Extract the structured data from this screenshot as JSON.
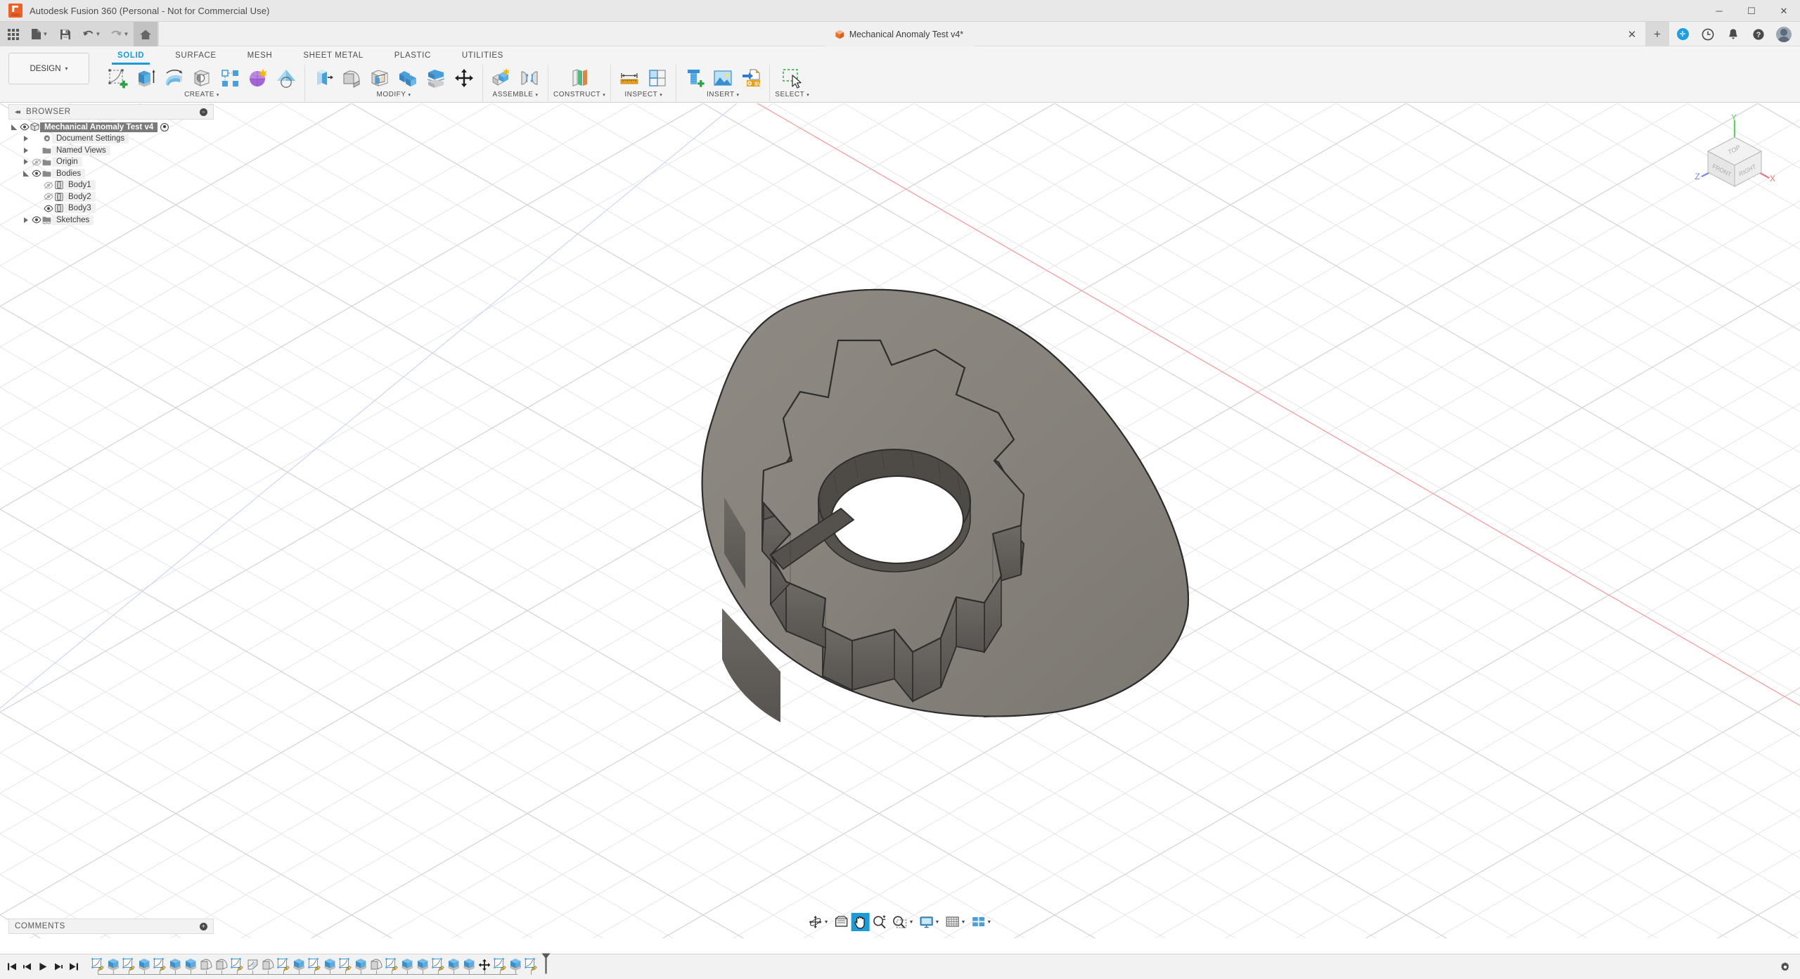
{
  "window": {
    "app_title": "Autodesk Fusion 360 (Personal - Not for Commercial Use)",
    "minimize": "─",
    "maximize": "☐",
    "close": "✕"
  },
  "quick_access": {
    "items": [
      {
        "name": "app-grid",
        "icon": "grid-icon",
        "label": "Apps"
      },
      {
        "name": "new-file",
        "icon": "file-icon",
        "label": "New",
        "has_carat": true
      },
      {
        "name": "save",
        "icon": "save-icon",
        "label": "Save"
      },
      {
        "name": "undo",
        "icon": "undo-icon",
        "label": "Undo",
        "has_carat": true
      },
      {
        "name": "redo",
        "icon": "redo-icon",
        "label": "Redo",
        "has_carat": true
      },
      {
        "name": "home",
        "icon": "home-icon",
        "label": "Home"
      }
    ]
  },
  "document_tab": {
    "title": "Mechanical Anomaly Test v4*",
    "icon": "cube-icon",
    "close_label": "✕",
    "new_tab_label": "+"
  },
  "account_bar": {
    "items": [
      {
        "name": "extension-badge",
        "icon": "plus-circle-icon"
      },
      {
        "name": "job-status",
        "icon": "clock-icon"
      },
      {
        "name": "notifications",
        "icon": "bell-icon"
      },
      {
        "name": "help",
        "icon": "question-icon"
      },
      {
        "name": "user-avatar",
        "icon": "avatar-icon"
      }
    ]
  },
  "workspace": {
    "label": "DESIGN",
    "carat": "▾"
  },
  "ribbon": {
    "tabs": [
      {
        "label": "SOLID",
        "active": true
      },
      {
        "label": "SURFACE",
        "active": false
      },
      {
        "label": "MESH",
        "active": false
      },
      {
        "label": "SHEET METAL",
        "active": false
      },
      {
        "label": "PLASTIC",
        "active": false
      },
      {
        "label": "UTILITIES",
        "active": false
      }
    ],
    "panels": [
      {
        "label": "CREATE",
        "carat": "▾",
        "tools": [
          {
            "name": "create-sketch-button",
            "icon": "sketch-plus-icon"
          },
          {
            "name": "extrude-button",
            "icon": "extrude-icon"
          },
          {
            "name": "revolve-button",
            "icon": "revolve-icon"
          },
          {
            "name": "hole-button",
            "icon": "hole-icon"
          },
          {
            "name": "rectangular-pattern-button",
            "icon": "pattern-icon"
          },
          {
            "name": "sphere-button",
            "icon": "sphere-icon"
          },
          {
            "name": "cone-button",
            "icon": "cone-icon"
          }
        ]
      },
      {
        "label": "MODIFY",
        "carat": "▾",
        "tools": [
          {
            "name": "press-pull-button",
            "icon": "press-pull-icon"
          },
          {
            "name": "fillet-button",
            "icon": "fillet-icon"
          },
          {
            "name": "shell-button",
            "icon": "shell-icon"
          },
          {
            "name": "combine-button",
            "icon": "combine-icon"
          },
          {
            "name": "split-face-button",
            "icon": "split-icon"
          },
          {
            "name": "move-copy-button",
            "icon": "move-arrows-icon"
          }
        ]
      },
      {
        "label": "ASSEMBLE",
        "carat": "▾",
        "tools": [
          {
            "name": "new-component-button",
            "icon": "new-component-icon"
          },
          {
            "name": "joint-button",
            "icon": "joint-icon"
          }
        ]
      },
      {
        "label": "CONSTRUCT",
        "carat": "▾",
        "tools": [
          {
            "name": "offset-plane-button",
            "icon": "offset-plane-icon"
          }
        ]
      },
      {
        "label": "INSPECT",
        "carat": "▾",
        "tools": [
          {
            "name": "measure-button",
            "icon": "ruler-icon"
          },
          {
            "name": "section-analysis-button",
            "icon": "section-icon"
          }
        ]
      },
      {
        "label": "INSERT",
        "carat": "▾",
        "tools": [
          {
            "name": "insert-mcmaster-button",
            "icon": "bolt-plus-icon"
          },
          {
            "name": "canvas-button",
            "icon": "image-icon"
          },
          {
            "name": "insert-svg-button",
            "icon": "svg-import-icon"
          }
        ]
      },
      {
        "label": "SELECT",
        "carat": "▾",
        "tools": [
          {
            "name": "select-button",
            "icon": "select-marquee-icon"
          }
        ]
      }
    ]
  },
  "browser": {
    "header": "BROWSER",
    "collapse_icon": "◂◂",
    "settings_icon": "⊖",
    "tree": [
      {
        "label": "Mechanical Anomaly Test v4",
        "depth": 0,
        "expander": "open",
        "eye": "visible",
        "icon": "component-icon",
        "selected": true,
        "has_radio": true
      },
      {
        "label": "Document Settings",
        "depth": 1,
        "expander": "closed",
        "eye": "none",
        "icon": "gear-icon",
        "selected": false,
        "has_radio": false
      },
      {
        "label": "Named Views",
        "depth": 1,
        "expander": "closed",
        "eye": "none",
        "icon": "folder-icon",
        "selected": false,
        "has_radio": false
      },
      {
        "label": "Origin",
        "depth": 1,
        "expander": "closed",
        "eye": "hidden",
        "icon": "folder-icon",
        "selected": false,
        "has_radio": false
      },
      {
        "label": "Bodies",
        "depth": 1,
        "expander": "open",
        "eye": "visible",
        "icon": "folder-icon",
        "selected": false,
        "has_radio": false
      },
      {
        "label": "Body1",
        "depth": 2,
        "expander": "none",
        "eye": "hidden",
        "icon": "body-icon",
        "selected": false,
        "has_radio": false
      },
      {
        "label": "Body2",
        "depth": 2,
        "expander": "none",
        "eye": "hidden",
        "icon": "body-icon",
        "selected": false,
        "has_radio": false
      },
      {
        "label": "Body3",
        "depth": 2,
        "expander": "none",
        "eye": "visible",
        "icon": "body-icon",
        "selected": false,
        "has_radio": false
      },
      {
        "label": "Sketches",
        "depth": 1,
        "expander": "closed",
        "eye": "visible",
        "icon": "sketch-folder-icon",
        "selected": false,
        "has_radio": false
      }
    ]
  },
  "comments": {
    "header": "COMMENTS",
    "add_icon": "⊕"
  },
  "viewcube": {
    "top_label": "TOP",
    "front_label": "FRONT",
    "right_label": "RIGHT",
    "axis_x": "X",
    "axis_y": "Y",
    "axis_z": "Z",
    "color_x": "#e8757f",
    "color_y": "#5ed05e",
    "color_z": "#7b86e8"
  },
  "navigation_bar": {
    "items": [
      {
        "name": "orbit-button",
        "icon": "orbit-icon",
        "has_carat": true,
        "active": false
      },
      {
        "name": "look-at-button",
        "icon": "look-at-icon",
        "has_carat": false,
        "active": false
      },
      {
        "name": "pan-button",
        "icon": "hand-icon",
        "has_carat": false,
        "active": true
      },
      {
        "name": "zoom-button",
        "icon": "magnifier-plus-icon",
        "has_carat": false,
        "active": false
      },
      {
        "name": "fit-button",
        "icon": "zoom-window-icon",
        "has_carat": true,
        "active": false
      },
      {
        "name": "display-settings-button",
        "icon": "monitor-icon",
        "has_carat": true,
        "active": false
      },
      {
        "name": "grid-snap-button",
        "icon": "grid-settings-icon",
        "has_carat": true,
        "active": false
      },
      {
        "name": "viewports-button",
        "icon": "viewports-icon",
        "has_carat": true,
        "active": false
      }
    ]
  },
  "timeline": {
    "playback": [
      {
        "name": "go-to-beginning-button",
        "icon": "skip-start-icon"
      },
      {
        "name": "step-back-button",
        "icon": "step-back-icon"
      },
      {
        "name": "play-button",
        "icon": "play-icon"
      },
      {
        "name": "step-forward-button",
        "icon": "step-forward-icon"
      },
      {
        "name": "go-to-end-button",
        "icon": "skip-end-icon"
      }
    ],
    "features": [
      {
        "name": "sketch-feature",
        "icon": "sketch-icon"
      },
      {
        "name": "extrude-feature",
        "icon": "extrude-icon"
      },
      {
        "name": "sketch-feature",
        "icon": "sketch-icon"
      },
      {
        "name": "extrude-feature",
        "icon": "extrude-icon"
      },
      {
        "name": "sketch-feature",
        "icon": "sketch-icon"
      },
      {
        "name": "extrude-feature",
        "icon": "extrude-icon"
      },
      {
        "name": "extrude-feature",
        "icon": "extrude-icon"
      },
      {
        "name": "fillet-feature",
        "icon": "fillet-icon"
      },
      {
        "name": "fillet-feature",
        "icon": "fillet-icon"
      },
      {
        "name": "sketch-feature",
        "icon": "sketch-icon"
      },
      {
        "name": "chamfer-feature",
        "icon": "chamfer-icon"
      },
      {
        "name": "fillet-feature",
        "icon": "fillet-icon"
      },
      {
        "name": "sketch-feature",
        "icon": "sketch-icon"
      },
      {
        "name": "extrude-feature",
        "icon": "extrude-icon"
      },
      {
        "name": "sketch-feature",
        "icon": "sketch-icon"
      },
      {
        "name": "extrude-feature",
        "icon": "extrude-icon"
      },
      {
        "name": "sketch-feature",
        "icon": "sketch-icon"
      },
      {
        "name": "extrude-feature",
        "icon": "extrude-icon"
      },
      {
        "name": "fillet-feature",
        "icon": "fillet-icon"
      },
      {
        "name": "sketch-feature",
        "icon": "sketch-icon"
      },
      {
        "name": "extrude-feature",
        "icon": "extrude-icon"
      },
      {
        "name": "extrude-feature",
        "icon": "extrude-icon"
      },
      {
        "name": "sketch-feature",
        "icon": "sketch-icon"
      },
      {
        "name": "extrude-feature",
        "icon": "extrude-icon"
      },
      {
        "name": "extrude-feature",
        "icon": "extrude-icon"
      },
      {
        "name": "move-feature",
        "icon": "move-icon"
      },
      {
        "name": "sketch-feature",
        "icon": "sketch-icon"
      },
      {
        "name": "extrude-feature",
        "icon": "extrude-icon"
      },
      {
        "name": "sketch-feature",
        "icon": "sketch-icon"
      }
    ],
    "settings_icon": "gear-icon"
  },
  "model": {
    "body_fill": "#85817a",
    "body_fill_dark": "#6b6761",
    "body_fill_side": "#565350",
    "outline": "#2b2b2b",
    "hole_fill": "#ffffff"
  },
  "canvas": {
    "grid_color": "#e0e0e0",
    "grid_color_major": "#cfcfcf",
    "axis_x_color": "#f0a0a6",
    "background": "#ffffff"
  }
}
